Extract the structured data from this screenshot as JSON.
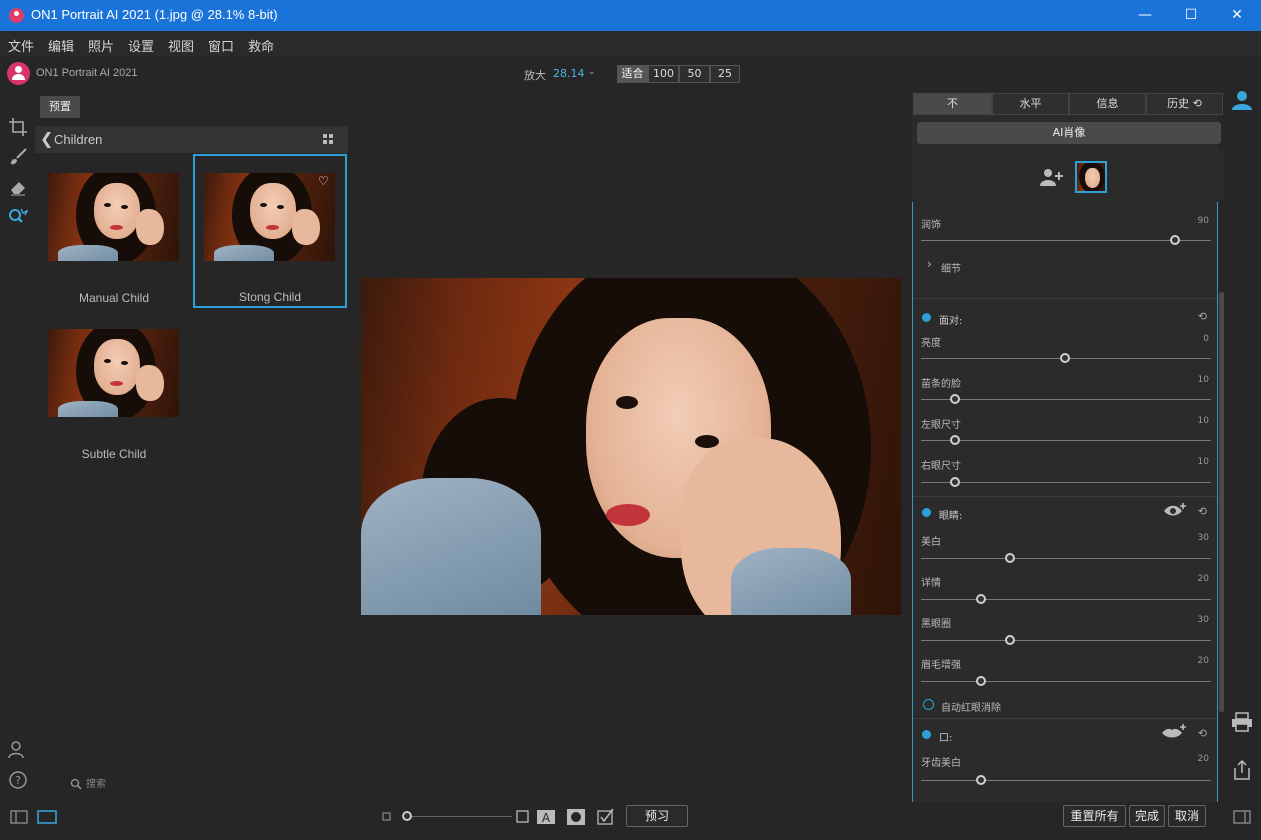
{
  "window": {
    "title": "ON1 Portrait AI 2021 (1.jpg @ 28.1% 8-bit)",
    "minimize": "—",
    "maximize": "☐",
    "close": "✕"
  },
  "menu": [
    "文件",
    "编辑",
    "照片",
    "设置",
    "视图",
    "窗口",
    "救命"
  ],
  "app_name": "ON1 Portrait AI 2021",
  "zoom": {
    "label": "放大",
    "value": "28.14",
    "chevron": "⌄",
    "buttons": [
      "适合",
      "100",
      "50",
      "25"
    ]
  },
  "browser": {
    "tab": "预置",
    "back": "❮",
    "folder": "Children",
    "presets": [
      {
        "label": "Manual Child"
      },
      {
        "label": "Stong Child",
        "heart": "♡"
      },
      {
        "label": "Subtle Child"
      }
    ],
    "search_placeholder": "搜索"
  },
  "right_panel": {
    "tabs": [
      "不",
      "水平",
      "信息",
      "历史 ⟲"
    ],
    "ai_button": "AI肖像",
    "top_slider": {
      "label": "润饰",
      "value": "90",
      "pos": 0.88
    },
    "detail_toggle": "›",
    "detail_label": "细节",
    "face": {
      "title": "面对:",
      "sliders": [
        {
          "label": "亮度",
          "value": "0",
          "pos": 0.5
        },
        {
          "label": "苗条的脸",
          "value": "10",
          "pos": 0.12
        },
        {
          "label": "左眼尺寸",
          "value": "10",
          "pos": 0.12
        },
        {
          "label": "右眼尺寸",
          "value": "10",
          "pos": 0.12
        }
      ]
    },
    "eyes": {
      "title": "眼睛:",
      "sliders": [
        {
          "label": "美白",
          "value": "30",
          "pos": 0.31
        },
        {
          "label": "详情",
          "value": "20",
          "pos": 0.21
        },
        {
          "label": "黑眼圈",
          "value": "30",
          "pos": 0.31
        },
        {
          "label": "眉毛增强",
          "value": "20",
          "pos": 0.21
        }
      ],
      "checkbox": "自动红眼消除"
    },
    "mouth": {
      "title": "口:",
      "sliders": [
        {
          "label": "牙齿美白",
          "value": "20",
          "pos": 0.21
        }
      ]
    },
    "reset_glyph": "⟲"
  },
  "bottom": {
    "preview": "预习",
    "reset_all": "重置所有",
    "done": "完成",
    "cancel": "取消"
  }
}
